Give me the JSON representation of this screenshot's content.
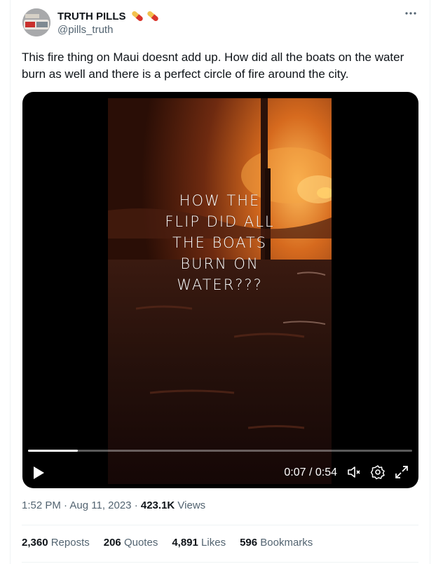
{
  "tweet": {
    "author_name": "TRUTH PILLS",
    "author_handle": "@pills_truth",
    "text": "This fire thing on Maui doesnt add up.  How did all the boats on the water burn as well and there is a perfect circle of fire around the city."
  },
  "icons": {
    "pill": "pill-icon",
    "more": "more-icon",
    "play": "play-icon",
    "mute": "volume-muted-icon",
    "settings": "gear-icon",
    "fullscreen": "expand-icon"
  },
  "video": {
    "overlay_lines": [
      "HOW THE",
      "FLIP DID ALL",
      "THE BOATS",
      "BURN ON",
      "WATER???"
    ],
    "current_time": "0:07",
    "duration": "0:54",
    "time_display": "0:07 / 0:54",
    "progress_fraction": 0.13
  },
  "meta": {
    "time": "1:52 PM",
    "date": "Aug 11, 2023",
    "views_count": "423.1K",
    "views_label": "Views"
  },
  "stats": {
    "reposts_count": "2,360",
    "reposts_label": "Reposts",
    "quotes_count": "206",
    "quotes_label": "Quotes",
    "likes_count": "4,891",
    "likes_label": "Likes",
    "bookmarks_count": "596",
    "bookmarks_label": "Bookmarks"
  },
  "colors": {
    "text_primary": "#0f1419",
    "text_secondary": "#536471",
    "divider": "#eff3f4",
    "pill_red": "#d9342b",
    "pill_yellow": "#f2c14e"
  }
}
